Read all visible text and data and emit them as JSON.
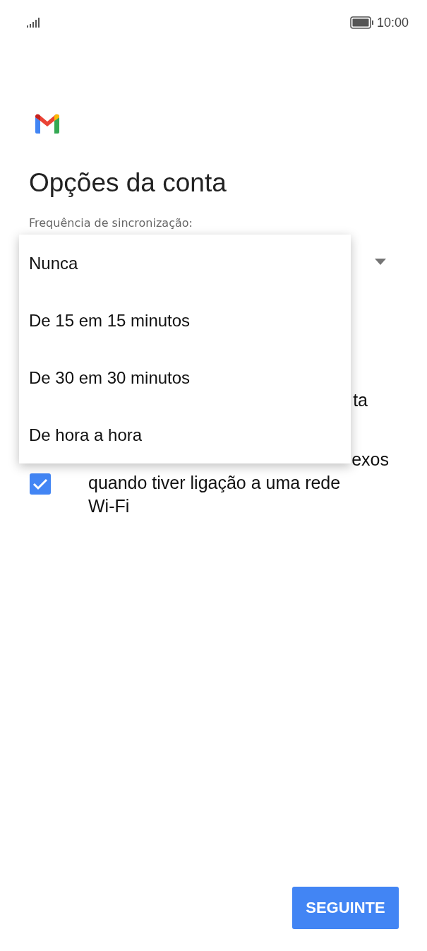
{
  "status_bar": {
    "time": "10:00"
  },
  "title": "Opções da conta",
  "sync_label": "Frequência de sincronização:",
  "dropdown": {
    "expanded": true,
    "options": [
      {
        "label": "Nunca"
      },
      {
        "label": "De 15 em 15 minutos"
      },
      {
        "label": "De 30 em 30 minutos"
      },
      {
        "label": "De hora a hora"
      }
    ]
  },
  "options": [
    {
      "kind": "text",
      "label": "ta"
    },
    {
      "kind": "checkbox",
      "label_fragment": "exos",
      "label": "quando tiver ligação a uma rede Wi-Fi",
      "checked": true
    }
  ],
  "next_button": "SEGUINTE"
}
